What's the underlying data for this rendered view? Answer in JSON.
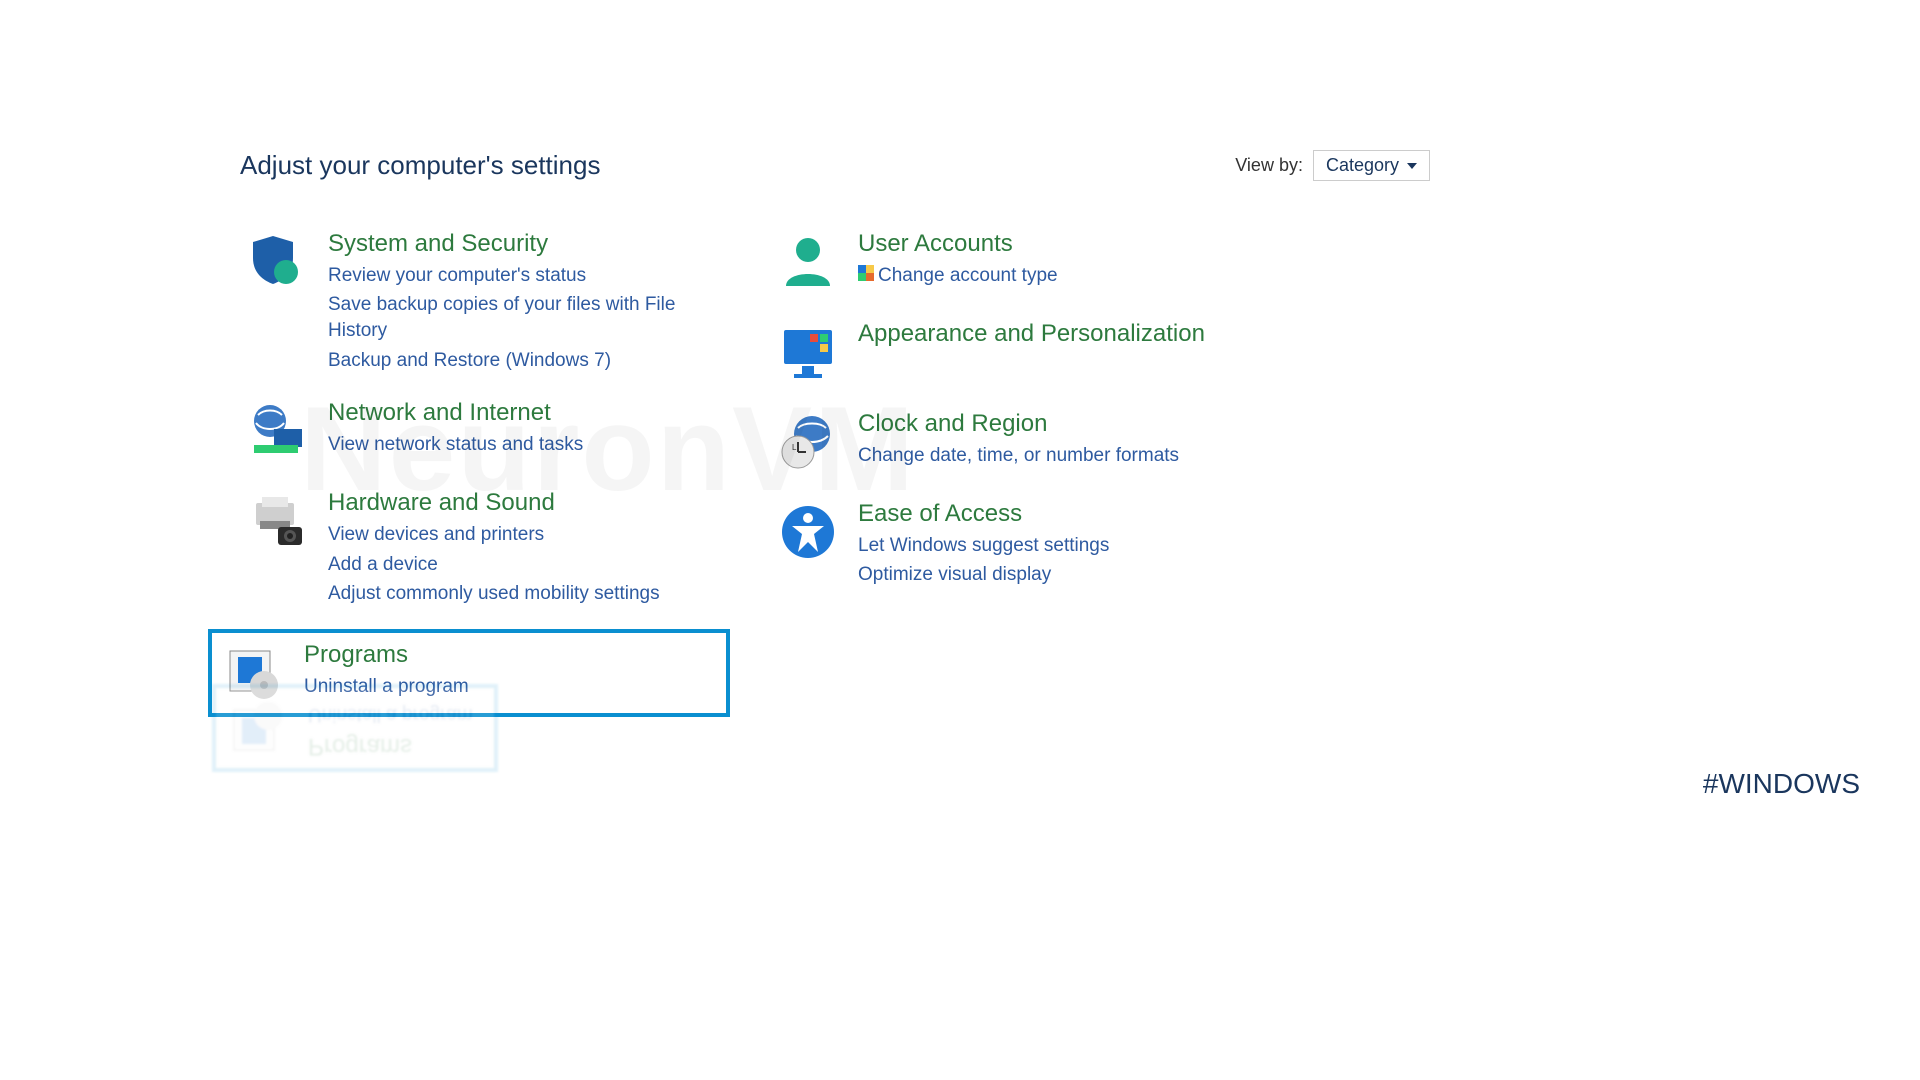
{
  "header": {
    "title": "Adjust your computer's settings",
    "view_by_label": "View by:",
    "view_by_value": "Category"
  },
  "left": [
    {
      "title": "System and Security",
      "links": [
        "Review your computer's status",
        "Save backup copies of your files with File History",
        "Backup and Restore (Windows 7)"
      ]
    },
    {
      "title": "Network and Internet",
      "links": [
        "View network status and tasks"
      ]
    },
    {
      "title": "Hardware and Sound",
      "links": [
        "View devices and printers",
        "Add a device",
        "Adjust commonly used mobility settings"
      ]
    },
    {
      "title": "Programs",
      "links": [
        "Uninstall a program"
      ],
      "selected": true
    }
  ],
  "right": [
    {
      "title": "User Accounts",
      "links": [
        "Change account type"
      ],
      "shield_on_first": true
    },
    {
      "title": "Appearance and Personalization",
      "links": []
    },
    {
      "title": "Clock and Region",
      "links": [
        "Change date, time, or number formats"
      ]
    },
    {
      "title": "Ease of Access",
      "links": [
        "Let Windows suggest settings",
        "Optimize visual display"
      ]
    }
  ],
  "watermark": "NeuronVM",
  "hashtag": "#WINDOWS"
}
